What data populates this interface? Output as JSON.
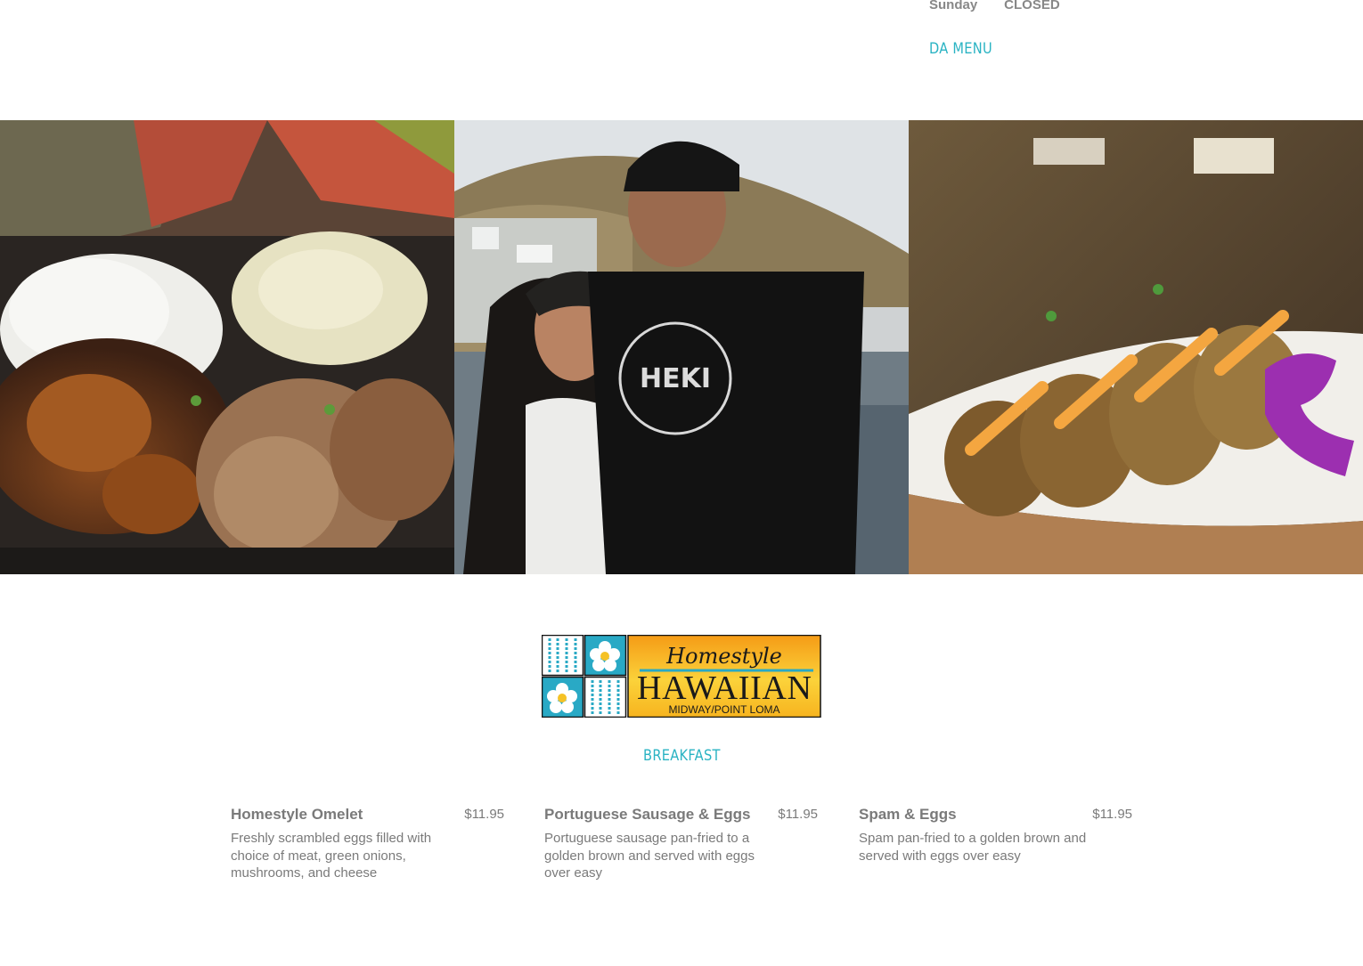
{
  "hours": {
    "day": "Sunday",
    "status": "CLOSED"
  },
  "nav": {
    "menu_link": "DA MENU"
  },
  "gallery": {
    "photos": [
      {
        "name": "plate-lunch-photo",
        "alt": "Plate lunch with rice, mac salad, teriyaki and fried chicken"
      },
      {
        "name": "owners-photo",
        "alt": "Couple smiling by a harbor"
      },
      {
        "name": "spam-musubi-photo",
        "alt": "Fried rolls drizzled with sauce and an orchid"
      }
    ]
  },
  "logo": {
    "script_text": "Homestyle",
    "main_text": "HAWAIIAN",
    "sub_text": "MIDWAY/POINT LOMA",
    "colors": {
      "teal": "#29a9c5",
      "orange": "#f7a11a",
      "yellow": "#fde24a"
    }
  },
  "menu": {
    "section_title": "BREAKFAST",
    "items": [
      {
        "name": "Homestyle Omelet",
        "price": "$11.95",
        "description": "Freshly scrambled eggs filled with choice of meat, green onions, mushrooms, and cheese"
      },
      {
        "name": "Portuguese Sausage & Eggs",
        "price": "$11.95",
        "description": "Portuguese sausage pan-fried to a golden brown and served with eggs over easy"
      },
      {
        "name": "Spam & Eggs",
        "price": "$11.95",
        "description": "Spam pan-fried to a golden brown and served with eggs over easy"
      }
    ]
  },
  "accent_color": "#2ab3c3"
}
